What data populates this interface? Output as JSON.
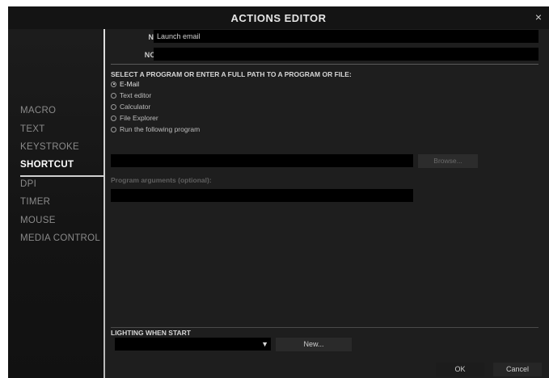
{
  "window": {
    "title": "ACTIONS EDITOR",
    "close_glyph": "×"
  },
  "sidebar": {
    "items": [
      {
        "label": "MACRO"
      },
      {
        "label": "TEXT"
      },
      {
        "label": "KEYSTROKE"
      },
      {
        "label": "SHORTCUT"
      },
      {
        "label": "DPI"
      },
      {
        "label": "TIMER"
      },
      {
        "label": "MOUSE"
      },
      {
        "label": "MEDIA CONTROL"
      }
    ],
    "active": "SHORTCUT"
  },
  "form": {
    "name_label": "NAME:",
    "name_value": "Launch email",
    "notes_label": "NOTES:",
    "notes_value": ""
  },
  "program": {
    "section_title": "SELECT A PROGRAM OR ENTER A FULL PATH TO A PROGRAM OR FILE:",
    "options": [
      {
        "label": "E-Mail",
        "checked": true
      },
      {
        "label": "Text editor",
        "checked": false
      },
      {
        "label": "Calculator",
        "checked": false
      },
      {
        "label": "File Explorer",
        "checked": false
      },
      {
        "label": "Run the following program",
        "checked": false
      }
    ],
    "path_value": "",
    "browse_label": "Browse...",
    "args_label": "Program arguments (optional):",
    "args_value": ""
  },
  "lighting": {
    "section_title": "LIGHTING WHEN START",
    "selected_value": "",
    "dropdown_arrow": "▼",
    "new_label": "New..."
  },
  "footer": {
    "ok_label": "OK",
    "cancel_label": "Cancel"
  },
  "icons": {
    "close": "close-icon",
    "dropdown": "chevron-down-icon",
    "radio": "radio-icon"
  }
}
